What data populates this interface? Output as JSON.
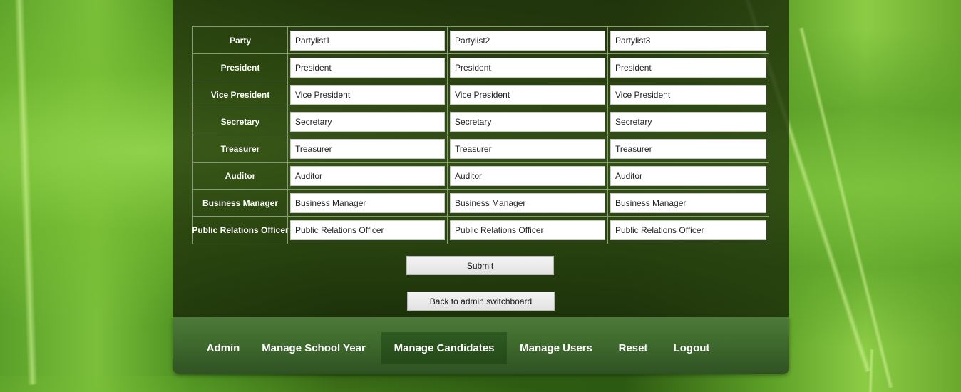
{
  "roles": [
    "Party",
    "President",
    "Vice President",
    "Secretary",
    "Treasurer",
    "Auditor",
    "Business Manager",
    "Public Relations Officer"
  ],
  "columns": [
    {
      "values": [
        "Partylist1",
        "President",
        "Vice President",
        "Secretary",
        "Treasurer",
        "Auditor",
        "Business Manager",
        "Public Relations Officer"
      ]
    },
    {
      "values": [
        "Partylist2",
        "President",
        "Vice President",
        "Secretary",
        "Treasurer",
        "Auditor",
        "Business Manager",
        "Public Relations Officer"
      ]
    },
    {
      "values": [
        "Partylist3",
        "President",
        "Vice President",
        "Secretary",
        "Treasurer",
        "Auditor",
        "Business Manager",
        "Public Relations Officer"
      ]
    }
  ],
  "buttons": {
    "submit": "Submit",
    "back": "Back to admin switchboard"
  },
  "nav": {
    "items": [
      "Admin",
      "Manage School Year",
      "Manage Candidates",
      "Manage Users",
      "Reset",
      "Logout"
    ],
    "active": "Manage Candidates"
  },
  "colors": {
    "panel": "#23370c",
    "nav_active": "#2a5220",
    "nav_bar": "#426d30"
  }
}
